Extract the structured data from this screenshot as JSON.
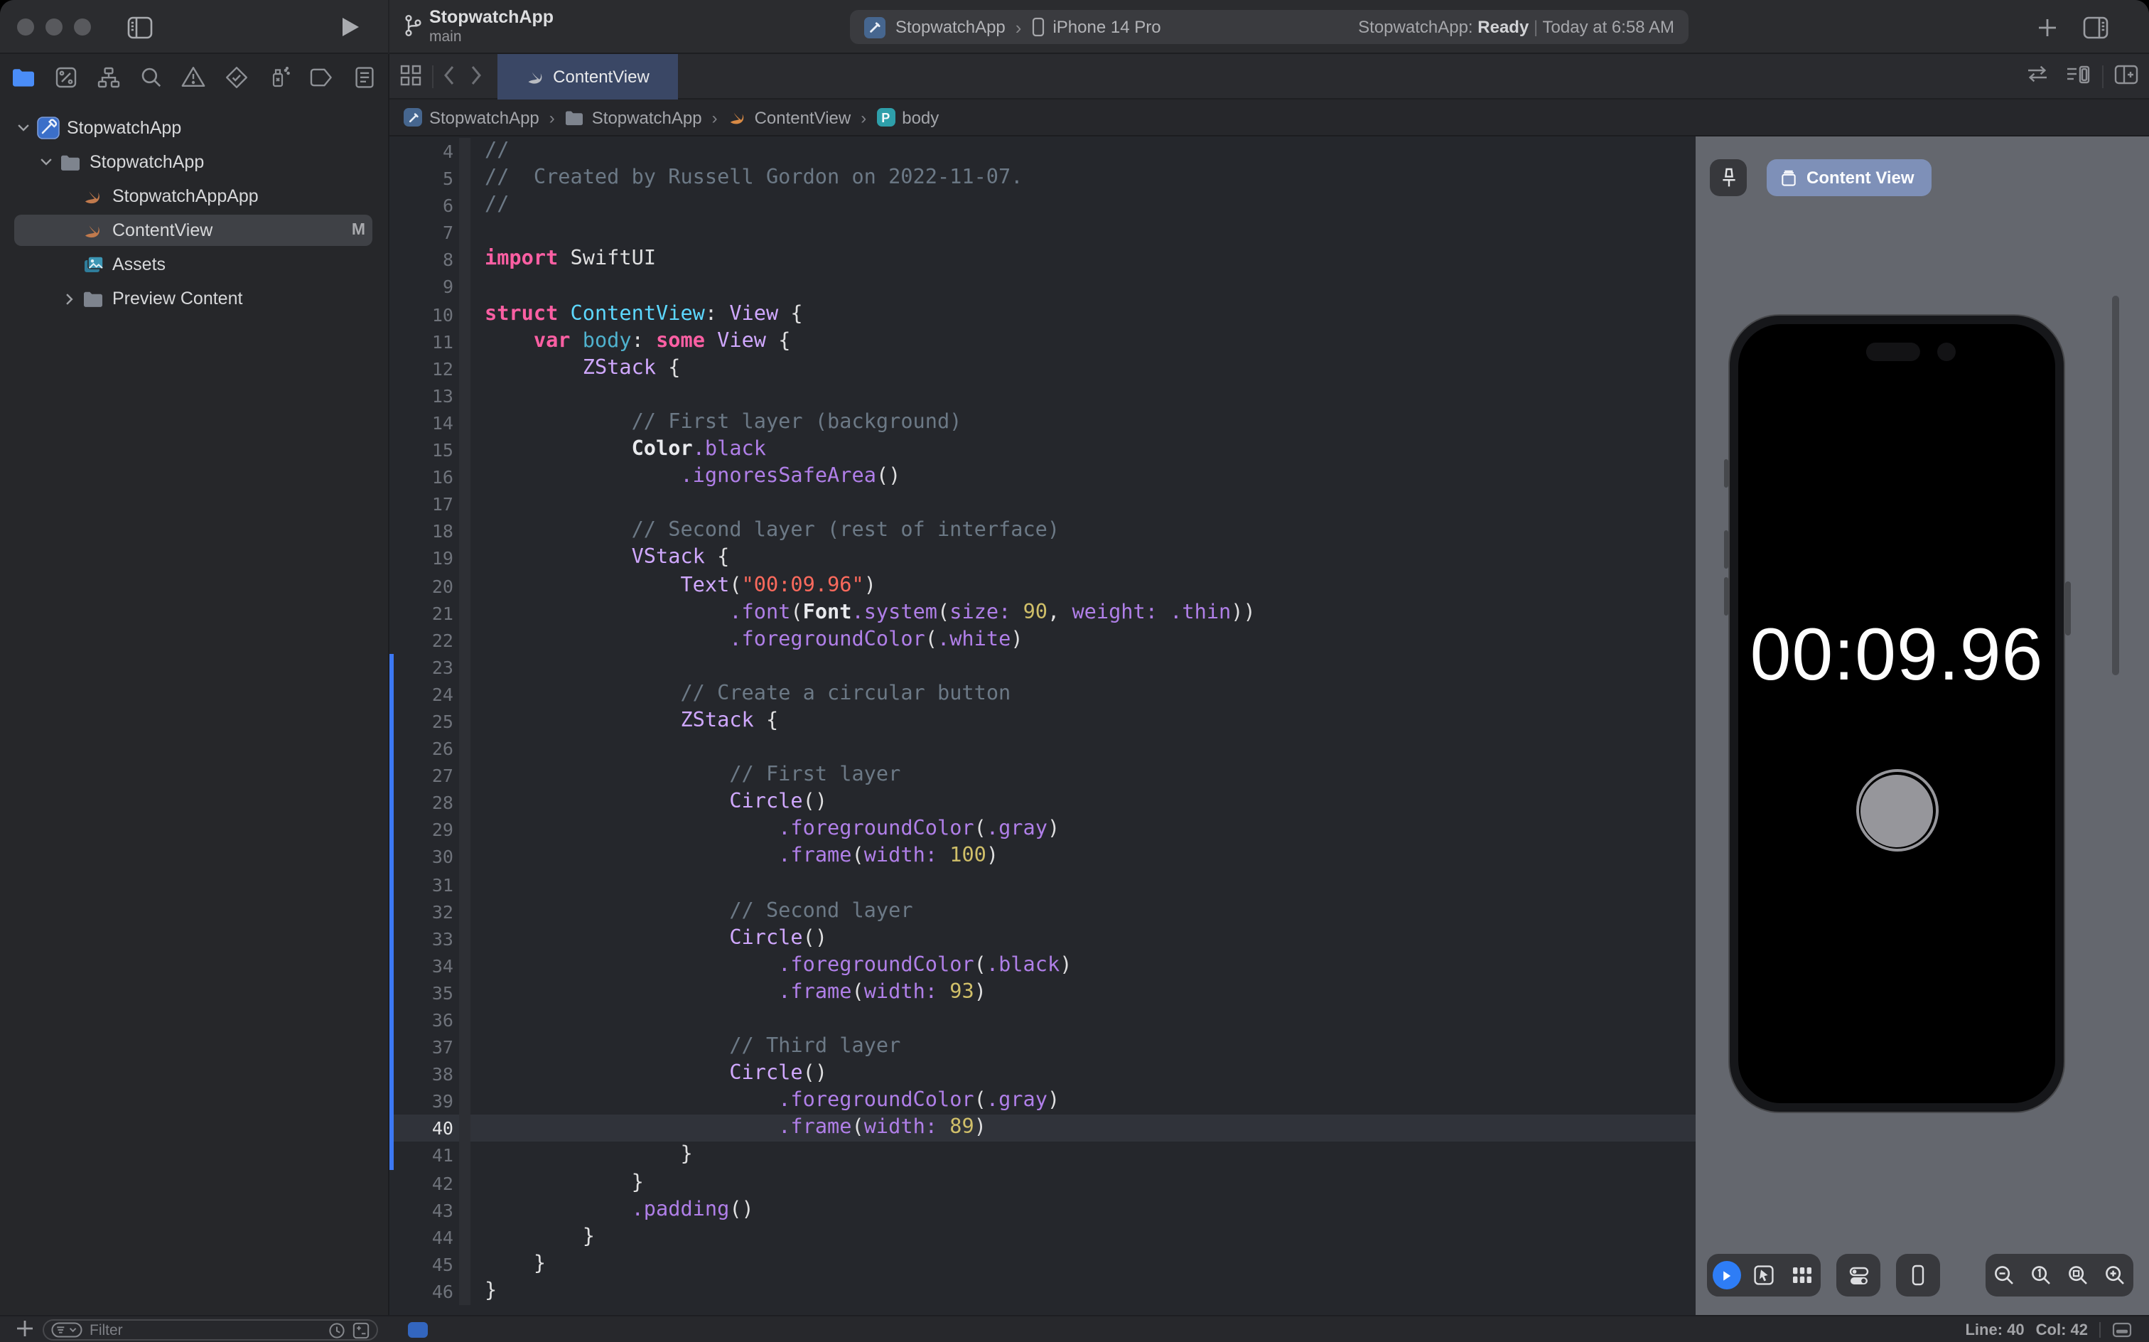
{
  "window": {
    "title": "StopwatchApp",
    "subtitle": "main"
  },
  "toolbar": {
    "scheme_app": "StopwatchApp",
    "scheme_device": "iPhone 14 Pro",
    "status_app": "StopwatchApp:",
    "status_state": "Ready",
    "status_sep": "|",
    "status_time": "Today at 6:58 AM"
  },
  "sidebar": {
    "navigator_icons": [
      "project-navigator-icon",
      "source-control-icon",
      "symbols-icon",
      "find-icon",
      "issues-icon",
      "tests-icon",
      "debug-icon",
      "breakpoints-icon",
      "reports-icon"
    ],
    "tree": [
      {
        "label": "StopwatchApp",
        "icon": "project-icon",
        "level": 0,
        "disclosure": "open"
      },
      {
        "label": "StopwatchApp",
        "icon": "folder-icon",
        "level": 1,
        "disclosure": "open"
      },
      {
        "label": "StopwatchAppApp",
        "icon": "swift-file-icon",
        "level": 2
      },
      {
        "label": "ContentView",
        "icon": "swift-file-icon",
        "level": 2,
        "selected": true,
        "badge": "M"
      },
      {
        "label": "Assets",
        "icon": "assets-icon",
        "level": 2
      },
      {
        "label": "Preview Content",
        "icon": "folder-icon",
        "level": 2,
        "disclosure": "closed"
      }
    ],
    "filter_placeholder": "Filter"
  },
  "editor": {
    "tab_label": "ContentView",
    "breadcrumbs": [
      "StopwatchApp",
      "StopwatchApp",
      "ContentView",
      "body"
    ],
    "code": {
      "current_line": 40,
      "changed_start": 23,
      "changed_end": 41,
      "lines": [
        {
          "n": 4,
          "t": [
            [
              "c",
              "//"
            ]
          ]
        },
        {
          "n": 5,
          "t": [
            [
              "c",
              "//  Created by Russell Gordon on 2022-11-07."
            ]
          ]
        },
        {
          "n": 6,
          "t": [
            [
              "c",
              "//"
            ]
          ]
        },
        {
          "n": 7,
          "t": []
        },
        {
          "n": 8,
          "t": [
            [
              "k",
              "import"
            ],
            [
              "w",
              " SwiftUI"
            ]
          ]
        },
        {
          "n": 9,
          "t": []
        },
        {
          "n": 10,
          "t": [
            [
              "k",
              "struct"
            ],
            [
              "w",
              " "
            ],
            [
              "d",
              "ContentView"
            ],
            [
              "w",
              ": "
            ],
            [
              "t",
              "View"
            ],
            [
              "w",
              " {"
            ]
          ]
        },
        {
          "n": 11,
          "t": [
            [
              "w",
              "    "
            ],
            [
              "k",
              "var"
            ],
            [
              "w",
              " "
            ],
            [
              "d2",
              "body"
            ],
            [
              "w",
              ": "
            ],
            [
              "k",
              "some"
            ],
            [
              "w",
              " "
            ],
            [
              "t",
              "View"
            ],
            [
              "w",
              " {"
            ]
          ]
        },
        {
          "n": 12,
          "t": [
            [
              "w",
              "        "
            ],
            [
              "t",
              "ZStack"
            ],
            [
              "w",
              " {"
            ]
          ]
        },
        {
          "n": 13,
          "t": []
        },
        {
          "n": 14,
          "t": [
            [
              "w",
              "            "
            ],
            [
              "c",
              "// First layer (background)"
            ]
          ]
        },
        {
          "n": 15,
          "t": [
            [
              "w",
              "            "
            ],
            [
              "wb",
              "Color"
            ],
            [
              "m",
              ".black"
            ]
          ]
        },
        {
          "n": 16,
          "t": [
            [
              "w",
              "                "
            ],
            [
              "m",
              ".ignoresSafeArea"
            ],
            [
              "w",
              "()"
            ]
          ]
        },
        {
          "n": 17,
          "t": []
        },
        {
          "n": 18,
          "t": [
            [
              "w",
              "            "
            ],
            [
              "c",
              "// Second layer (rest of interface)"
            ]
          ]
        },
        {
          "n": 19,
          "t": [
            [
              "w",
              "            "
            ],
            [
              "t",
              "VStack"
            ],
            [
              "w",
              " {"
            ]
          ]
        },
        {
          "n": 20,
          "t": [
            [
              "w",
              "                "
            ],
            [
              "t",
              "Text"
            ],
            [
              "w",
              "("
            ],
            [
              "s",
              "\"00:09.96\""
            ],
            [
              "w",
              ")"
            ]
          ]
        },
        {
          "n": 21,
          "t": [
            [
              "w",
              "                    "
            ],
            [
              "m",
              ".font"
            ],
            [
              "w",
              "("
            ],
            [
              "wb",
              "Font"
            ],
            [
              "m",
              ".system"
            ],
            [
              "w",
              "("
            ],
            [
              "m",
              "size:"
            ],
            [
              "w",
              " "
            ],
            [
              "n2",
              "90"
            ],
            [
              "w",
              ", "
            ],
            [
              "m",
              "weight:"
            ],
            [
              "w",
              " "
            ],
            [
              "m",
              ".thin"
            ],
            [
              "w",
              "))"
            ]
          ]
        },
        {
          "n": 22,
          "t": [
            [
              "w",
              "                    "
            ],
            [
              "m",
              ".foregroundColor"
            ],
            [
              "w",
              "("
            ],
            [
              "m",
              ".white"
            ],
            [
              "w",
              ")"
            ]
          ]
        },
        {
          "n": 23,
          "t": []
        },
        {
          "n": 24,
          "t": [
            [
              "w",
              "                "
            ],
            [
              "c",
              "// Create a circular button"
            ]
          ]
        },
        {
          "n": 25,
          "t": [
            [
              "w",
              "                "
            ],
            [
              "t",
              "ZStack"
            ],
            [
              "w",
              " {"
            ]
          ]
        },
        {
          "n": 26,
          "t": []
        },
        {
          "n": 27,
          "t": [
            [
              "w",
              "                    "
            ],
            [
              "c",
              "// First layer"
            ]
          ]
        },
        {
          "n": 28,
          "t": [
            [
              "w",
              "                    "
            ],
            [
              "t",
              "Circle"
            ],
            [
              "w",
              "()"
            ]
          ]
        },
        {
          "n": 29,
          "t": [
            [
              "w",
              "                        "
            ],
            [
              "m",
              ".foregroundColor"
            ],
            [
              "w",
              "("
            ],
            [
              "m",
              ".gray"
            ],
            [
              "w",
              ")"
            ]
          ]
        },
        {
          "n": 30,
          "t": [
            [
              "w",
              "                        "
            ],
            [
              "m",
              ".frame"
            ],
            [
              "w",
              "("
            ],
            [
              "m",
              "width:"
            ],
            [
              "w",
              " "
            ],
            [
              "n2",
              "100"
            ],
            [
              "w",
              ")"
            ]
          ]
        },
        {
          "n": 31,
          "t": []
        },
        {
          "n": 32,
          "t": [
            [
              "w",
              "                    "
            ],
            [
              "c",
              "// Second layer"
            ]
          ]
        },
        {
          "n": 33,
          "t": [
            [
              "w",
              "                    "
            ],
            [
              "t",
              "Circle"
            ],
            [
              "w",
              "()"
            ]
          ]
        },
        {
          "n": 34,
          "t": [
            [
              "w",
              "                        "
            ],
            [
              "m",
              ".foregroundColor"
            ],
            [
              "w",
              "("
            ],
            [
              "m",
              ".black"
            ],
            [
              "w",
              ")"
            ]
          ]
        },
        {
          "n": 35,
          "t": [
            [
              "w",
              "                        "
            ],
            [
              "m",
              ".frame"
            ],
            [
              "w",
              "("
            ],
            [
              "m",
              "width:"
            ],
            [
              "w",
              " "
            ],
            [
              "n2",
              "93"
            ],
            [
              "w",
              ")"
            ]
          ]
        },
        {
          "n": 36,
          "t": []
        },
        {
          "n": 37,
          "t": [
            [
              "w",
              "                    "
            ],
            [
              "c",
              "// Third layer"
            ]
          ]
        },
        {
          "n": 38,
          "t": [
            [
              "w",
              "                    "
            ],
            [
              "t",
              "Circle"
            ],
            [
              "w",
              "()"
            ]
          ]
        },
        {
          "n": 39,
          "t": [
            [
              "w",
              "                        "
            ],
            [
              "m",
              ".foregroundColor"
            ],
            [
              "w",
              "("
            ],
            [
              "m",
              ".gray"
            ],
            [
              "w",
              ")"
            ]
          ]
        },
        {
          "n": 40,
          "t": [
            [
              "w",
              "                        "
            ],
            [
              "m",
              ".frame"
            ],
            [
              "w",
              "("
            ],
            [
              "m",
              "width:"
            ],
            [
              "w",
              " "
            ],
            [
              "n2",
              "89"
            ],
            [
              "w",
              ")"
            ]
          ]
        },
        {
          "n": 41,
          "t": [
            [
              "w",
              "                }"
            ]
          ]
        },
        {
          "n": 42,
          "t": [
            [
              "w",
              "            }"
            ]
          ]
        },
        {
          "n": 43,
          "t": [
            [
              "w",
              "            "
            ],
            [
              "m",
              ".padding"
            ],
            [
              "w",
              "()"
            ]
          ]
        },
        {
          "n": 44,
          "t": [
            [
              "w",
              "        }"
            ]
          ]
        },
        {
          "n": 45,
          "t": [
            [
              "w",
              "    }"
            ]
          ]
        },
        {
          "n": 46,
          "t": [
            [
              "w",
              "}"
            ]
          ]
        }
      ]
    }
  },
  "canvas": {
    "preview_label": "Content View",
    "time_display": "00:09.96",
    "toolbar_icons": [
      "live-preview-icon",
      "selectable-preview-icon",
      "variants-icon",
      "device-settings-icon",
      "preview-on-device-icon",
      "zoom-out-icon",
      "zoom-actual-size-icon",
      "zoom-to-fit-icon",
      "zoom-in-icon"
    ]
  },
  "statusbar": {
    "line_label": "Line: 40",
    "col_label": "Col: 42"
  },
  "colors": {
    "accent_blue": "#2E7DF6",
    "tab_active": "#3A4765",
    "change_bar": "#3C78F3",
    "canvas_bg": "#64676E",
    "preview_pill": "#7E90B8",
    "syntax_keyword": "#FC5FA3",
    "syntax_type": "#D0A8FF",
    "syntax_member": "#B07FE8",
    "syntax_string": "#FC6A5D",
    "syntax_number": "#D0BF69",
    "syntax_comment": "#6C7986",
    "syntax_decl": "#5DD8FF"
  }
}
